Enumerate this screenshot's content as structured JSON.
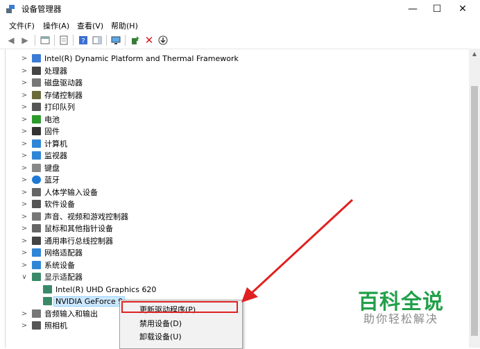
{
  "window": {
    "title": "设备管理器",
    "minimize": "—",
    "maximize": "☐",
    "close": "✕"
  },
  "menubar": [
    "文件(F)",
    "操作(A)",
    "查看(V)",
    "帮助(H)"
  ],
  "toolbar": [
    "back-icon",
    "forward-icon",
    "properties-icon",
    "console-icon",
    "help-icon",
    "action-pane-icon",
    "monitor-icon",
    "update-driver-icon",
    "uninstall-icon",
    "scan-icon"
  ],
  "tree": [
    {
      "label": "Intel(R) Dynamic Platform and Thermal Framework",
      "icon": "device-icon",
      "expander": ">"
    },
    {
      "label": "处理器",
      "icon": "processor-icon",
      "expander": ">"
    },
    {
      "label": "磁盘驱动器",
      "icon": "disk-icon",
      "expander": ">"
    },
    {
      "label": "存储控制器",
      "icon": "storage-icon",
      "expander": ">"
    },
    {
      "label": "打印队列",
      "icon": "printer-icon",
      "expander": ">"
    },
    {
      "label": "电池",
      "icon": "battery-icon",
      "expander": ">"
    },
    {
      "label": "固件",
      "icon": "firmware-icon",
      "expander": ">"
    },
    {
      "label": "计算机",
      "icon": "computer-icon",
      "expander": ">"
    },
    {
      "label": "监视器",
      "icon": "monitor-icon",
      "expander": ">"
    },
    {
      "label": "键盘",
      "icon": "keyboard-icon",
      "expander": ">"
    },
    {
      "label": "蓝牙",
      "icon": "bluetooth-icon",
      "expander": ">"
    },
    {
      "label": "人体学输入设备",
      "icon": "hid-icon",
      "expander": ">"
    },
    {
      "label": "软件设备",
      "icon": "software-icon",
      "expander": ">"
    },
    {
      "label": "声音、视频和游戏控制器",
      "icon": "speaker-icon",
      "expander": ">"
    },
    {
      "label": "鼠标和其他指针设备",
      "icon": "mouse-icon",
      "expander": ">"
    },
    {
      "label": "通用串行总线控制器",
      "icon": "usb-icon",
      "expander": ">"
    },
    {
      "label": "网络适配器",
      "icon": "network-icon",
      "expander": ">"
    },
    {
      "label": "系统设备",
      "icon": "system-icon",
      "expander": ">"
    },
    {
      "label": "显示适配器",
      "icon": "display-adapter-icon",
      "expander": "∨"
    },
    {
      "label": "Intel(R) UHD Graphics 620",
      "icon": "display-adapter-icon",
      "expander": "",
      "child": true
    },
    {
      "label": "NVIDIA GeForce 9",
      "icon": "display-adapter-icon",
      "expander": "",
      "child": true,
      "selected": true
    },
    {
      "label": "音频输入和输出",
      "icon": "speaker-icon",
      "expander": ">"
    },
    {
      "label": "照相机",
      "icon": "camera-icon",
      "expander": ">"
    }
  ],
  "context_menu": [
    "更新驱动程序(P)",
    "禁用设备(D)",
    "卸载设备(U)"
  ],
  "watermark": {
    "title": "百科全说",
    "subtitle": "助你轻松解决"
  },
  "colors": {
    "highlight_red": "#e02020",
    "watermark_green": "#22a04a",
    "selection": "#cce8ff"
  }
}
